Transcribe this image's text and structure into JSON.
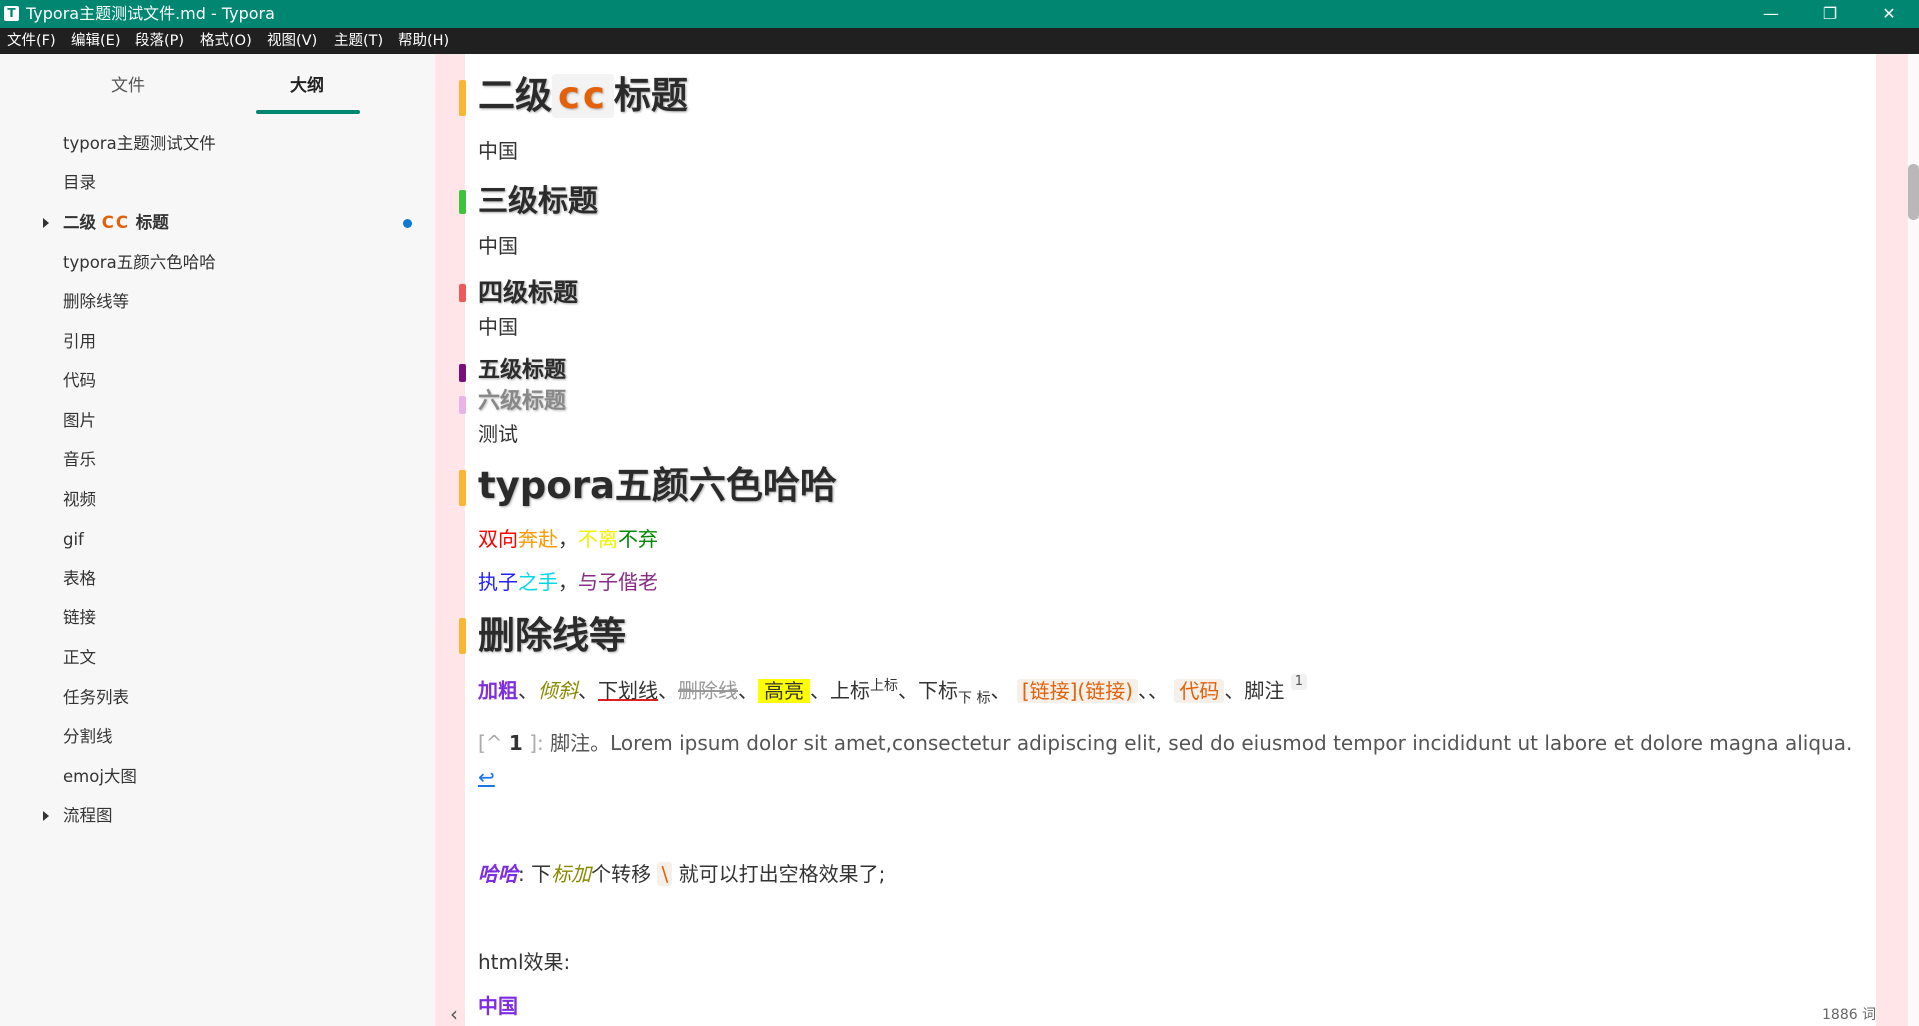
{
  "window": {
    "app_icon": "T",
    "title": "Typora主题测试文件.md - Typora",
    "controls": {
      "minimize": "—",
      "restore": "❐",
      "close": "✕"
    }
  },
  "menu": [
    "文件(F)",
    "编辑(E)",
    "段落(P)",
    "格式(O)",
    "视图(V)",
    "主题(T)",
    "帮助(H)"
  ],
  "sidebar": {
    "tabs": [
      "文件",
      "大纲"
    ],
    "active_tab": "大纲",
    "outline": [
      {
        "label": "typora主题测试文件"
      },
      {
        "label": "目录"
      },
      {
        "label_prefix": "二级",
        "label_code": "CC",
        "label_suffix": "标题",
        "bold": true,
        "expandable": true,
        "active": true
      },
      {
        "label": "typora五颜六色哈哈"
      },
      {
        "label": "删除线等"
      },
      {
        "label": "引用"
      },
      {
        "label": "代码"
      },
      {
        "label": "图片"
      },
      {
        "label": "音乐"
      },
      {
        "label": "视频"
      },
      {
        "label": "gif"
      },
      {
        "label": "表格"
      },
      {
        "label": "链接"
      },
      {
        "label": "正文"
      },
      {
        "label": "任务列表"
      },
      {
        "label": "分割线"
      },
      {
        "label": "emoj大图"
      },
      {
        "label": "流程图",
        "expandable": true
      }
    ]
  },
  "doc": {
    "h2_cc": {
      "prefix": "二级",
      "code": "cc",
      "suffix": "标题"
    },
    "p1": "中国",
    "h3": "三级标题",
    "p2": "中国",
    "h4": "四级标题",
    "p3": "中国",
    "h5": "五级标题",
    "h6": "六级标题",
    "p4": "测试",
    "h2_colors": "typora五颜六色哈哈",
    "color_line1": [
      {
        "text": "双向",
        "color": "#ff0000"
      },
      {
        "text": "奔赴",
        "color": "#ff9900"
      },
      {
        "text": "，",
        "color": "#333333"
      },
      {
        "text": "不离",
        "color": "#f0f000"
      },
      {
        "text": "不弃",
        "color": "#008800"
      }
    ],
    "color_line2": [
      {
        "text": "执子",
        "color": "#2222ff"
      },
      {
        "text": "之手",
        "color": "#00d8e8"
      },
      {
        "text": "，",
        "color": "#333333"
      },
      {
        "text": "与子偕老",
        "color": "#8a2b8a"
      }
    ],
    "h2_strike": "删除线等",
    "fmt": {
      "bold": "加粗",
      "italic": "倾斜",
      "underline": "下划线",
      "strike": "删除线",
      "highlight": "高亮",
      "sup_base": "上标",
      "sup": "上标",
      "sub_base": "下标",
      "sub": "下 标",
      "link_code": "[链接](链接)",
      "code": "代码",
      "footnote_label": "脚注",
      "footnote_ref": "1",
      "sep": "、"
    },
    "footnote": {
      "open": "[^",
      "num": "1",
      "close": "]:",
      "text": "脚注。Lorem ipsum dolor sit amet,consectetur adipiscing elit, sed do eiusmod tempor incididunt ut labore et dolore magna aliqua.",
      "back": "↩"
    },
    "haha": {
      "label": "哈哈",
      "colon": ":",
      "t1": "下",
      "t2": "标加",
      "t3": "个转移",
      "esc": "\\",
      "t4": "就可以打出空格效果了;"
    },
    "html_label": "html效果:",
    "html_cn": "中国"
  },
  "status": {
    "word_count": "1886 词",
    "collapse": "‹"
  },
  "colors": {
    "titlebar": "#008671",
    "accent": "#008671",
    "heading_bars": [
      "#f7b733",
      "#3cc43c",
      "#ee5a5a",
      "#7a0f7a",
      "#e8b4e8",
      "#f7b733",
      "#f7b733"
    ]
  }
}
